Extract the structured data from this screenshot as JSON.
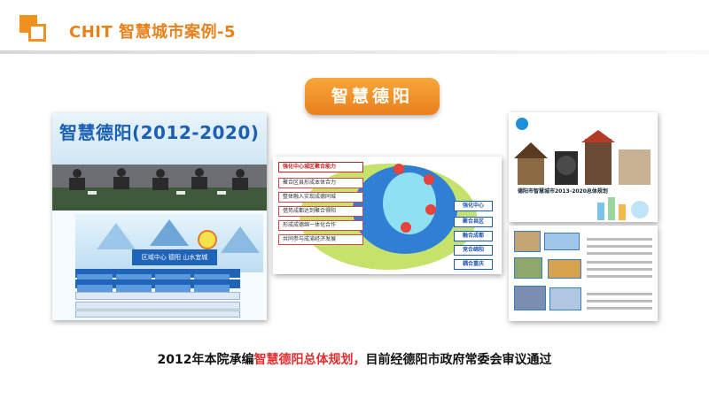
{
  "header": {
    "title": "CHIT 智慧城市案例-5"
  },
  "badge": {
    "label": "智慧德阳"
  },
  "images": {
    "cover": {
      "title": "智慧德阳(2012-2020)"
    },
    "structure": {
      "hall_label": "区域中心 德阳 山水宜城"
    },
    "framework": {
      "top_label": "强化中心城区聚合能力",
      "left_items": [
        "聚合区县形成本体合力",
        "整体融入实现成德同城",
        "借势成都达到聚合得阳",
        "形成成德绵一体化合作",
        "共同参与成渝经济发展"
      ],
      "right_items": [
        "强化中心",
        "聚合县区",
        "融合成都",
        "竞合绵阳",
        "耦合重庆"
      ]
    },
    "plan_cover": {
      "title": "德阳市智慧城市2013-2020总体规划"
    }
  },
  "caption": {
    "before": "2012年本院承编",
    "highlight": "智慧德阳总体规划，",
    "after": "目前经德阳市政府常委会审议通过"
  },
  "colors": {
    "accent": "#f0901e",
    "highlight": "#e03030",
    "primary_blue": "#1f64b8"
  }
}
